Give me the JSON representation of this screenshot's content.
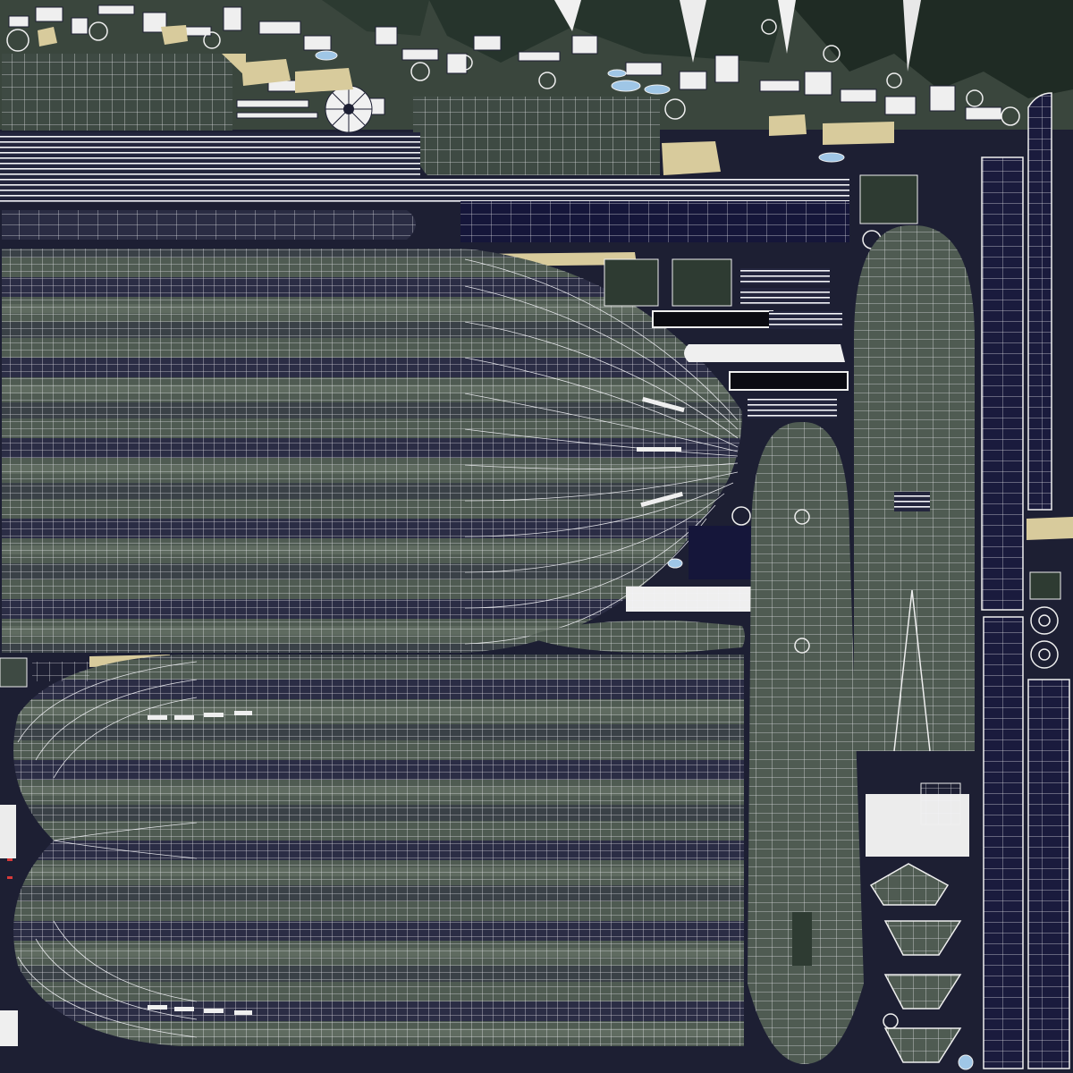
{
  "image": {
    "kind": "uv-texture-map-with-wireframe-overlay",
    "subject": "submarine hull",
    "palette": {
      "background": "#1d1f33",
      "hull_green": "#4f5b52",
      "hull_green_light": "#6c786c",
      "hull_dark_band": "#2a2c43",
      "wire": "#f4f4f8",
      "sand": "#d8cb9c",
      "navy_strip": "#1a1b3d",
      "shadow_green": "#2e3b32",
      "black": "#0b0b12",
      "accent_blue": "#9fc6e6",
      "accent_red": "#d83a3a"
    }
  }
}
